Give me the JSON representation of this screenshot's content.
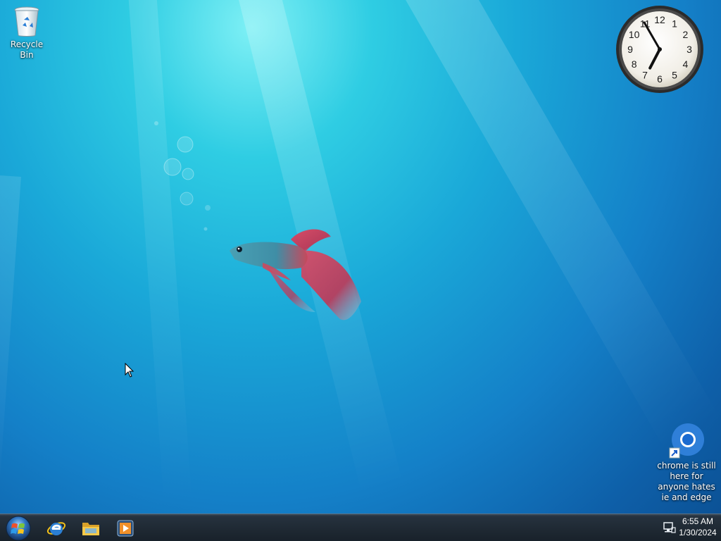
{
  "desktop": {
    "wallpaper": "windows-7-betta-fish",
    "icons": [
      {
        "label": "Recycle Bin",
        "icon": "recycle-bin-icon"
      },
      {
        "label": "chrome is still here for anyone hates ie and edge",
        "icon": "chrome-icon"
      }
    ]
  },
  "gadgets": {
    "clock": {
      "numerals": [
        "12",
        "1",
        "2",
        "3",
        "4",
        "5",
        "6",
        "7",
        "8",
        "9",
        "10",
        "11"
      ],
      "time": "6:55"
    }
  },
  "taskbar": {
    "start": {
      "icon": "windows-start-orb-icon"
    },
    "pinned": [
      {
        "name": "Internet Explorer",
        "icon": "internet-explorer-icon"
      },
      {
        "name": "Windows Explorer",
        "icon": "folder-icon"
      },
      {
        "name": "Windows Media Player",
        "icon": "media-player-icon"
      }
    ],
    "tray": {
      "network_icon": "network-icon",
      "time": "6:55 AM",
      "date": "1/30/2024"
    }
  },
  "colors": {
    "accent": "#1aa8d8",
    "taskbar": "#1e2832"
  }
}
